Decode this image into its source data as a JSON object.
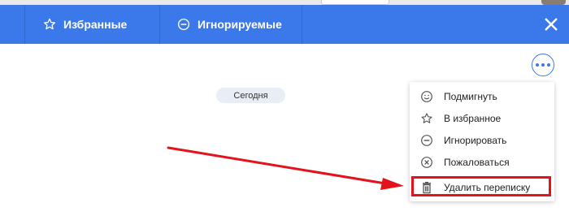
{
  "header": {
    "tabs": [
      {
        "label": "Избранные",
        "icon": "star-icon"
      },
      {
        "label": "Игнорируемые",
        "icon": "minus-circle-icon"
      }
    ],
    "close_icon": "close-icon",
    "background": "#3b78ea"
  },
  "chat": {
    "date_separator": "Сегодня",
    "more_icon": "more-dots-icon"
  },
  "menu": {
    "items": [
      {
        "label": "Подмигнуть",
        "icon": "smile-icon"
      },
      {
        "label": "В избранное",
        "icon": "star-icon"
      },
      {
        "label": "Игнорировать",
        "icon": "minus-circle-icon"
      },
      {
        "label": "Пожаловаться",
        "icon": "x-circle-icon"
      },
      {
        "label": "Удалить переписку",
        "icon": "trash-icon",
        "highlighted": true
      }
    ]
  },
  "annotation": {
    "arrow_color": "#e3121b",
    "highlight_color": "#e3121b"
  }
}
